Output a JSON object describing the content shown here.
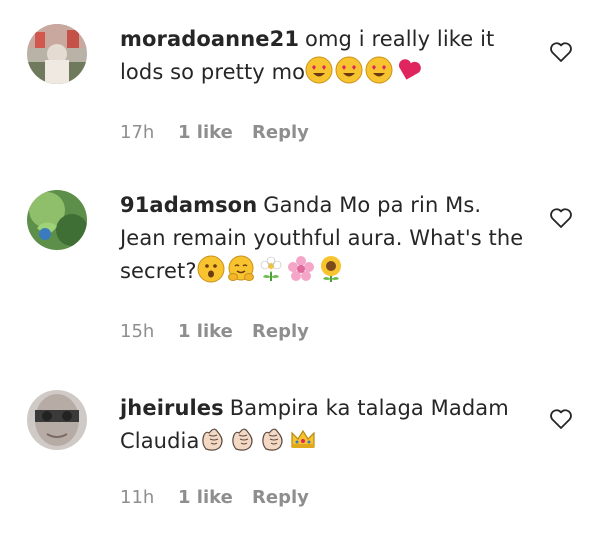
{
  "comments": [
    {
      "username": "moradoanne21",
      "text": "omg i really like it lods so pretty mo",
      "emojis": [
        "heart-eyes-face",
        "heart-eyes-face",
        "heart-eyes-face",
        "red-heart"
      ],
      "time": "17h",
      "likes": "1 like",
      "reply": "Reply"
    },
    {
      "username": "91adamson",
      "text": "Ganda Mo pa rin Ms. Jean remain youthful aura. What's the secret?",
      "emojis": [
        "surprised-face",
        "hugging-face",
        "blossom",
        "cherry-blossom",
        "sunflower"
      ],
      "time": "15h",
      "likes": "1 like",
      "reply": "Reply"
    },
    {
      "username": "jheirules",
      "text": "Bampira ka talaga Madam Claudia",
      "emojis": [
        "clapping-hands",
        "clapping-hands",
        "clapping-hands",
        "crown"
      ],
      "time": "11h",
      "likes": "1 like",
      "reply": "Reply"
    }
  ],
  "colors": {
    "text": "#262626",
    "meta": "#8e8e8e",
    "emoji_yellow": "#f7c32e",
    "heart_red": "#e0245e"
  }
}
